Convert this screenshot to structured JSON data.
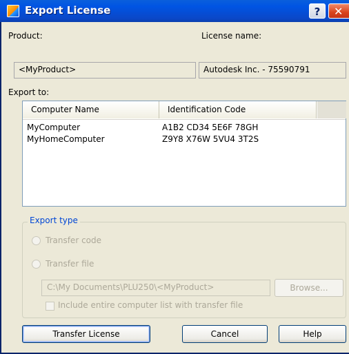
{
  "window": {
    "title": "Export License",
    "help_glyph": "?",
    "close_glyph": "✕"
  },
  "product": {
    "label": "Product:",
    "value": "<MyProduct>"
  },
  "license_name": {
    "label": "License name:",
    "value": "Autodesk Inc. - 75590791"
  },
  "export_to": {
    "label": "Export to:",
    "columns": [
      "Computer Name",
      "Identification Code"
    ],
    "rows": [
      {
        "computer": "MyComputer",
        "code": "A1B2 CD34 5E6F 78GH"
      },
      {
        "computer": "MyHomeComputer",
        "code": "Z9Y8 X76W 5VU4 3T2S"
      }
    ]
  },
  "export_type": {
    "title": "Export type",
    "options": [
      {
        "label": "Transfer code",
        "selected": false,
        "enabled": false
      },
      {
        "label": "Transfer file",
        "selected": false,
        "enabled": false
      }
    ],
    "path": "C:\\My Documents\\PLU250\\<MyProduct>",
    "browse_label": "Browse...",
    "include_checkbox": {
      "label": "Include entire computer list with transfer file",
      "checked": false,
      "enabled": false
    }
  },
  "buttons": {
    "transfer": "Transfer License",
    "cancel": "Cancel",
    "help": "Help"
  },
  "colors": {
    "title_bar": "#0054e3",
    "dialog_bg": "#ece9d8",
    "group_title": "#0046d5",
    "disabled_text": "#aca899"
  }
}
